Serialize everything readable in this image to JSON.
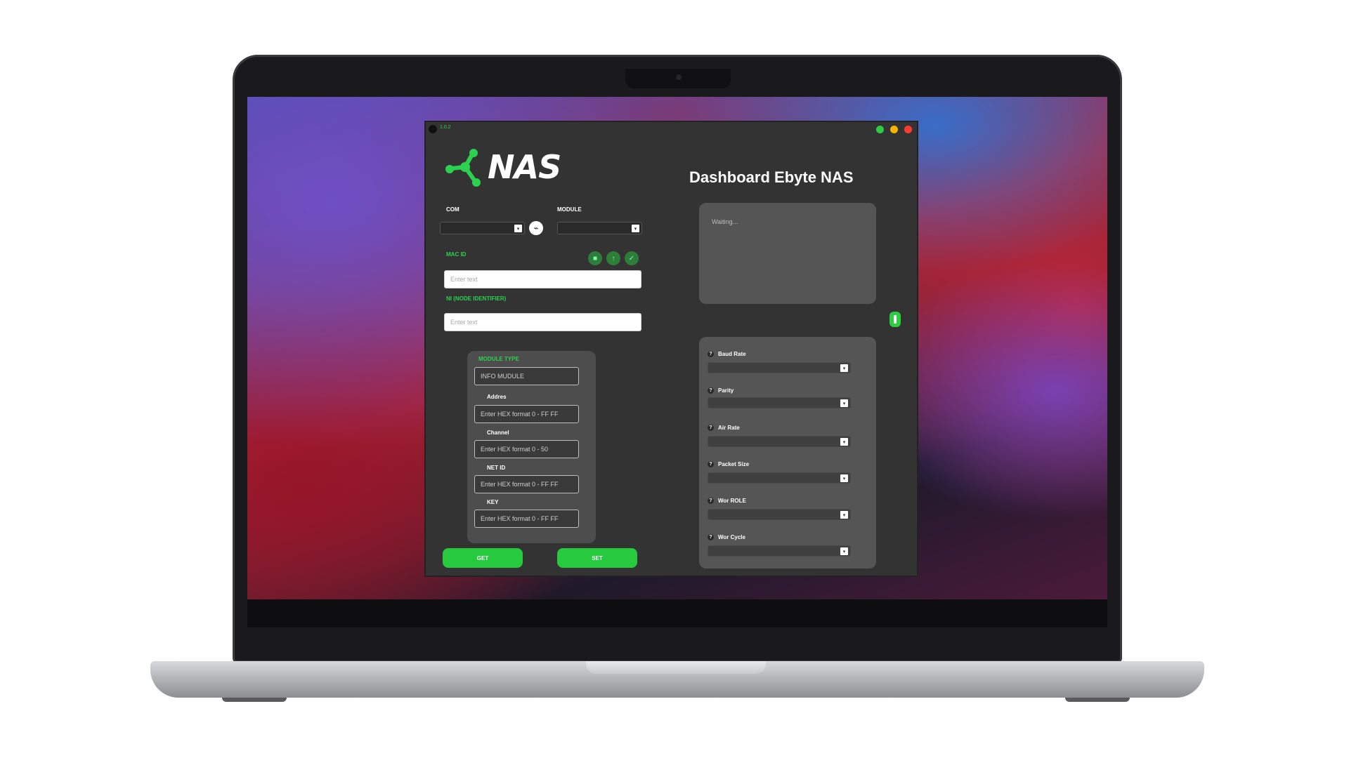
{
  "window": {
    "version": "1.0.2",
    "controls": [
      "minimize",
      "maximize",
      "close"
    ]
  },
  "app": {
    "logo_text": "NAS",
    "dashboard_title": "Dashboard Ebyte NAS"
  },
  "connection": {
    "com_label": "COM",
    "com_value": "",
    "module_label": "MODULE",
    "module_value": ""
  },
  "mac": {
    "label": "MAC ID",
    "placeholder": "Enter text",
    "actions": [
      "delete-icon",
      "upload-icon",
      "check-icon"
    ]
  },
  "ni": {
    "label": "NI (NODE IDENTIFIER)",
    "placeholder": "Enter text"
  },
  "module_type": {
    "label": "MODULE TYPE",
    "info_placeholder": "INFO MUDULE",
    "address_label": "Addres",
    "address_placeholder": "Enter HEX format 0 - FF FF",
    "channel_label": "Channel",
    "channel_placeholder": "Enter HEX format 0 - 50",
    "netid_label": "NET ID",
    "netid_placeholder": "Enter HEX format 0 - FF FF",
    "key_label": "KEY",
    "key_placeholder": "Enter HEX format 0 - FF FF"
  },
  "buttons": {
    "get": "GET",
    "set": "SET"
  },
  "log": {
    "text": "Waiting..."
  },
  "settings": {
    "items": [
      {
        "label": "Baud Rate",
        "value": ""
      },
      {
        "label": "Parity",
        "value": ""
      },
      {
        "label": "Air Rate",
        "value": ""
      },
      {
        "label": "Packet Size",
        "value": ""
      },
      {
        "label": "Wor ROLE",
        "value": ""
      },
      {
        "label": "Wor Cycle",
        "value": ""
      }
    ],
    "help_glyph": "?"
  },
  "colors": {
    "accent": "#27c93f",
    "window_bg": "#333333",
    "panel_bg": "#555555"
  }
}
